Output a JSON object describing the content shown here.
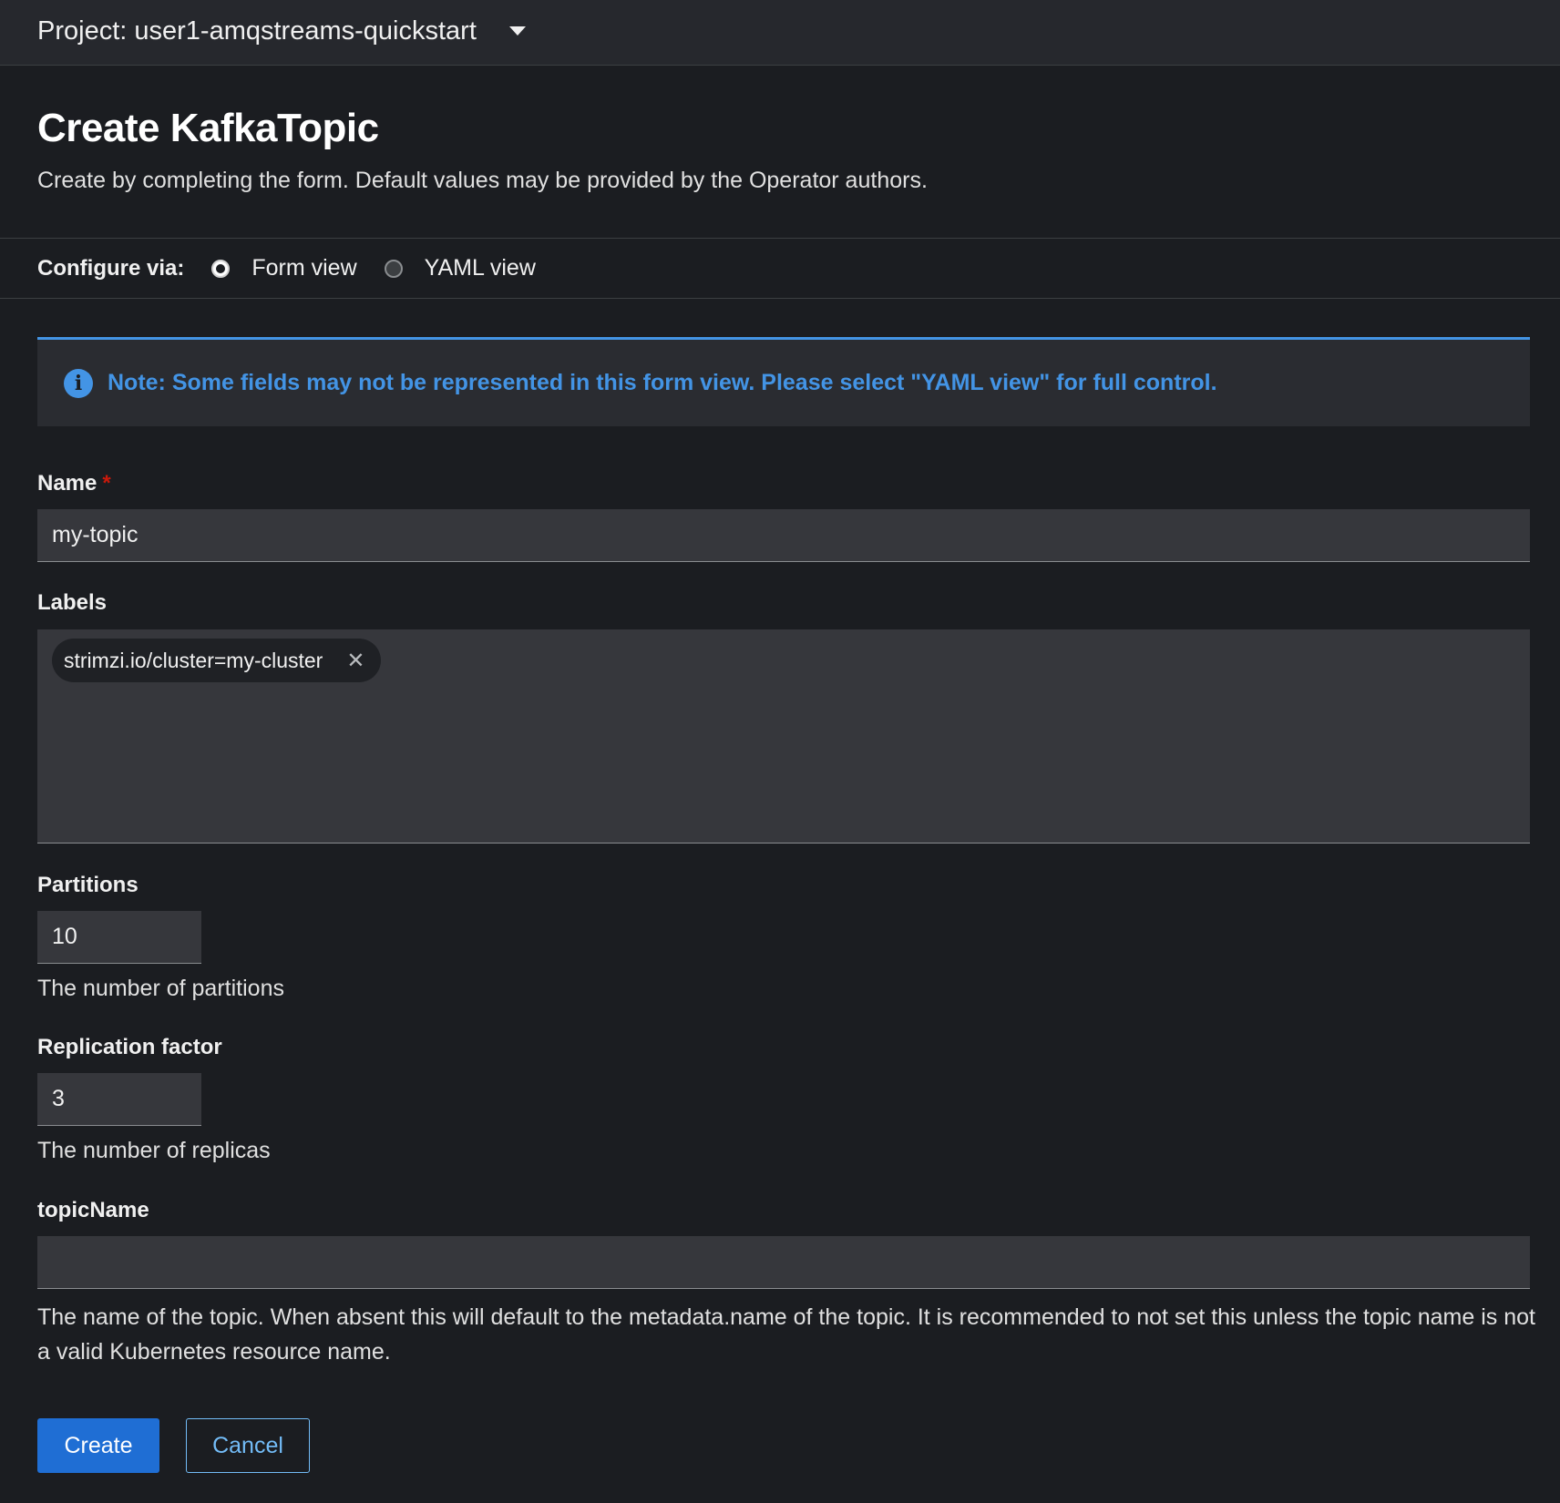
{
  "topbar": {
    "project_label": "Project: user1-amqstreams-quickstart",
    "dropdown_icon": "caret-down-icon"
  },
  "header": {
    "title": "Create KafkaTopic",
    "description": "Create by completing the form. Default values may be provided by the Operator authors."
  },
  "configure": {
    "label": "Configure via:",
    "options": [
      {
        "label": "Form view",
        "selected": true
      },
      {
        "label": "YAML view",
        "selected": false
      }
    ]
  },
  "alert": {
    "icon": "info-icon",
    "text": "Note: Some fields may not be represented in this form view. Please select \"YAML view\" for full control.",
    "color": "#4394e5"
  },
  "form": {
    "name": {
      "label": "Name",
      "required_marker": "*",
      "value": "my-topic"
    },
    "labels": {
      "label": "Labels",
      "chips": [
        "strimzi.io/cluster=my-cluster"
      ]
    },
    "partitions": {
      "label": "Partitions",
      "value": "10",
      "helper": "The number of partitions"
    },
    "replication": {
      "label": "Replication factor",
      "value": "3",
      "helper": "The number of replicas"
    },
    "topic_name": {
      "label": "topicName",
      "value": "",
      "helper": "The name of the topic. When absent this will default to the metadata.name of the topic. It is recommended to not set this unless the topic name is not a valid Kubernetes resource name."
    }
  },
  "actions": {
    "create_label": "Create",
    "cancel_label": "Cancel",
    "primary_color": "#1f6ed4"
  }
}
